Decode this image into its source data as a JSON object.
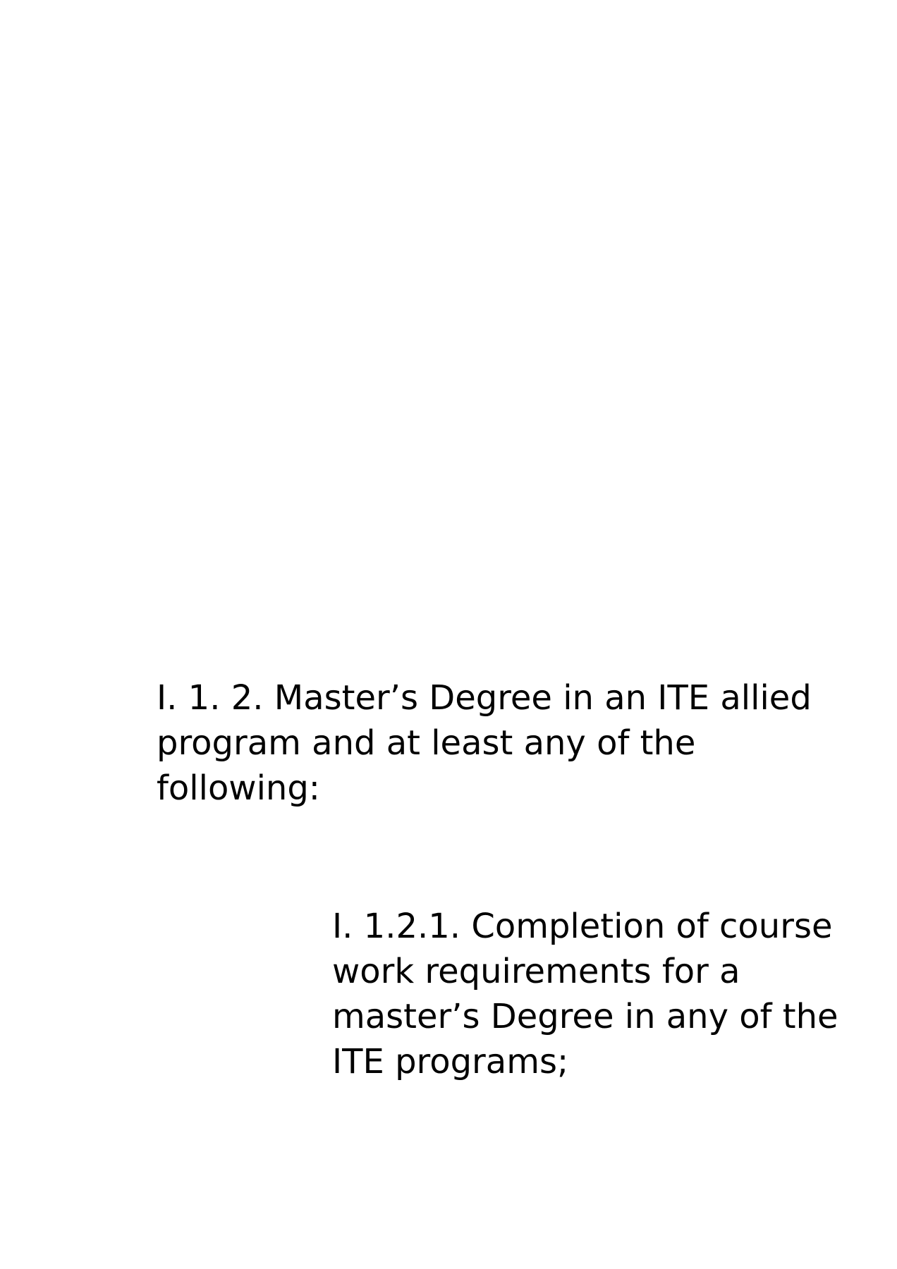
{
  "document": {
    "items": [
      {
        "lines": [
          "I. 1. 2. Master’s Degree in an ITE allied",
          "program and at least any of the",
          "following:"
        ]
      },
      {
        "lines": [
          "I. 1.2.1. Completion of course",
          "work requirements for a",
          "master’s Degree in any of the",
          "ITE programs;"
        ]
      }
    ]
  }
}
